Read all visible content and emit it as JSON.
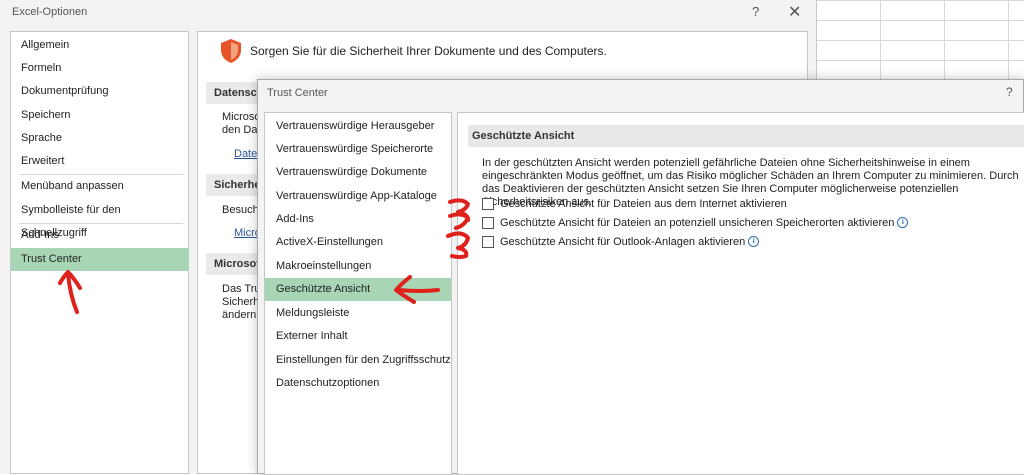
{
  "excel_options": {
    "title": "Excel-Optionen",
    "help": "?",
    "close": "✕",
    "sidebar": [
      {
        "label": "Allgemein"
      },
      {
        "label": "Formeln"
      },
      {
        "label": "Dokumentprüfung"
      },
      {
        "label": "Speichern"
      },
      {
        "label": "Sprache"
      },
      {
        "label": "Erweitert"
      },
      {
        "label": "Menüband anpassen"
      },
      {
        "label": "Symbolleiste für den Schnellzugriff"
      },
      {
        "label": "Add-Ins"
      },
      {
        "label": "Trust Center",
        "active": true
      }
    ],
    "headline": "Sorgen Sie für die Sicherheit Ihrer Dokumente und des Computers.",
    "sections": [
      {
        "head": "Datensch",
        "lines": [
          "Microso",
          "den Date"
        ],
        "link": "Daten"
      },
      {
        "head": "Sicherhei",
        "lines": [
          "Besuche"
        ],
        "link": "Micro"
      },
      {
        "head": "Microsof",
        "lines": [
          "Das Trus",
          "Sicherhe",
          "ändern."
        ]
      }
    ]
  },
  "trust_center": {
    "title": "Trust Center",
    "help": "?",
    "sidebar": [
      {
        "label": "Vertrauenswürdige Herausgeber"
      },
      {
        "label": "Vertrauenswürdige Speicherorte"
      },
      {
        "label": "Vertrauenswürdige Dokumente"
      },
      {
        "label": "Vertrauenswürdige App-Kataloge"
      },
      {
        "label": "Add-Ins"
      },
      {
        "label": "ActiveX-Einstellungen"
      },
      {
        "label": "Makroeinstellungen"
      },
      {
        "label": "Geschützte Ansicht",
        "active": true
      },
      {
        "label": "Meldungsleiste"
      },
      {
        "label": "Externer Inhalt"
      },
      {
        "label": "Einstellungen für den Zugriffsschutz"
      },
      {
        "label": "Datenschutzoptionen"
      }
    ],
    "section_head": "Geschützte Ansicht",
    "description": "In der geschützten Ansicht werden potenziell gefährliche Dateien ohne Sicherheitshinweise in einem eingeschränkten Modus geöffnet, um das Risiko möglicher Schäden an Ihrem Computer zu minimieren. Durch das Deaktivieren der geschützten Ansicht setzen Sie Ihren Computer möglicherweise potenziellen Sicherheitsrisiken aus.",
    "options": [
      {
        "label": "Geschützte Ansicht für Dateien aus dem Internet aktivieren",
        "checked": false,
        "info": false
      },
      {
        "label": "Geschützte Ansicht für Dateien an potenziell unsicheren Speicherorten aktivieren",
        "checked": false,
        "info": true
      },
      {
        "label": "Geschützte Ansicht für Outlook-Anlagen aktivieren",
        "checked": false,
        "info": true
      }
    ],
    "info_glyph": "i"
  },
  "colors": {
    "selected": "#a7d5b6",
    "annotation": "#e0201b",
    "shield": "#e8542a"
  }
}
